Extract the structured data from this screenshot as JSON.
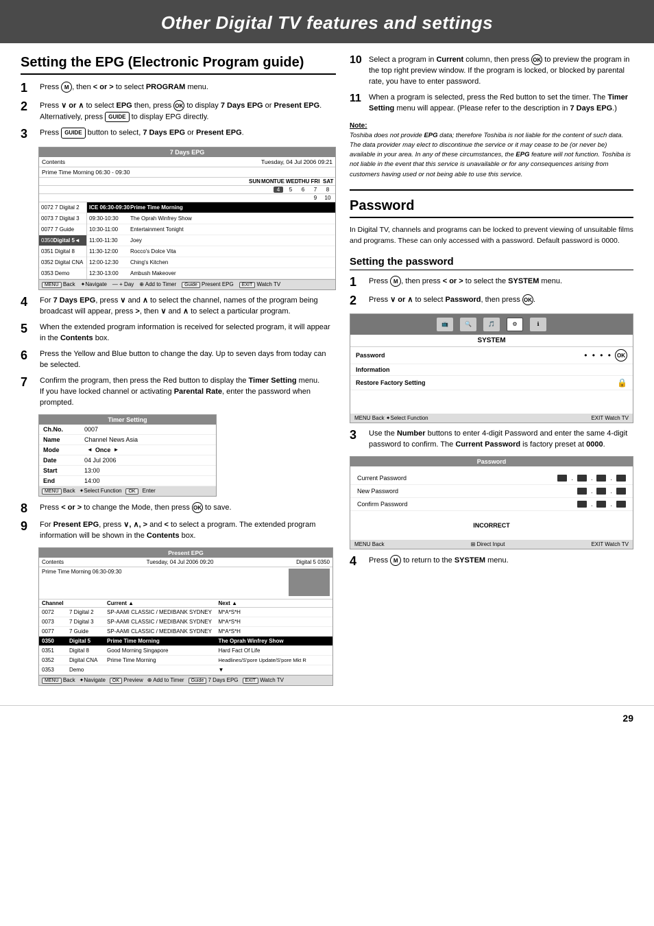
{
  "header": {
    "title": "Other Digital TV features and settings"
  },
  "left": {
    "section_title": "Setting the EPG (Electronic Program guide)",
    "steps": [
      {
        "num": "1",
        "text_parts": [
          "Press ",
          "MENU",
          ", then ",
          "< or >",
          " to select ",
          "PROGRAM",
          " menu."
        ]
      },
      {
        "num": "2",
        "text_parts": [
          "Press ",
          "∨ or ∧",
          " to select ",
          "EPG",
          " then, press ",
          "OK",
          " to display ",
          "7 Days EPG",
          " or ",
          "Present EPG",
          ". Alternatively, press ",
          "GUIDE",
          " to display EPG directly."
        ]
      },
      {
        "num": "3",
        "text_parts": [
          "Press ",
          "GUIDE",
          " button to select, ",
          "7 Days EPG",
          " or ",
          "Present EPG",
          "."
        ]
      }
    ],
    "epg_table": {
      "title": "7 Days EPG",
      "contents_label": "Contents",
      "date_label": "Tuesday, 04 Jul 2006 09:21",
      "program_label": "Prime Time Morning 06:30 - 09:30",
      "days": [
        "SUN",
        "MON",
        "TUE",
        "WED",
        "THU",
        "FRI",
        "SAT"
      ],
      "day_nums": [
        "4",
        "5",
        "6",
        "7",
        "8"
      ],
      "highlighted_day": "4",
      "extra_nums": [
        "9",
        "10"
      ],
      "channels": [
        {
          "num": "0072",
          "name": "7 Digital 2",
          "highlighted": false
        },
        {
          "num": "0073",
          "name": "7 Digital 3",
          "highlighted": false
        },
        {
          "num": "0077",
          "name": "7 Guide",
          "highlighted": false
        },
        {
          "num": "0350",
          "name": "Digital 5",
          "highlighted": true
        },
        {
          "num": "0351",
          "name": "Digital 8",
          "highlighted": false
        },
        {
          "num": "0352",
          "name": "Digital CNA",
          "highlighted": false
        },
        {
          "num": "0353",
          "name": "Demo",
          "highlighted": false
        }
      ],
      "programs": [
        {
          "time": "ICE 06:30-09:30",
          "name": "Prime Time Morning",
          "highlighted": true
        },
        {
          "time": "09:30-10:30",
          "name": "The Oprah Winfrey Show",
          "highlighted": false
        },
        {
          "time": "10:30-11:00",
          "name": "Entertainment Tonight",
          "highlighted": false
        },
        {
          "time": "11:00-11:30",
          "name": "Joey",
          "highlighted": false
        },
        {
          "time": "11:30-12:00",
          "name": "Rocco's Dolce Vita",
          "highlighted": false
        },
        {
          "time": "12:00-12:30",
          "name": "Ching's Kitchen",
          "highlighted": false
        },
        {
          "time": "12:30-13:00",
          "name": "Ambush Makeover",
          "highlighted": false
        }
      ],
      "footer_items": [
        "MENU Back",
        "✦Navigate",
        "— + Day",
        "⊕ Add to Timer",
        "Guide Present EPG",
        "EXIT Watch TV"
      ]
    },
    "steps4to7": [
      {
        "num": "4",
        "text": "For 7 Days EPG, press ∨ and ∧ to select the channel, names of the program being broadcast will appear, press >, then ∨ and ∧ to select a particular program."
      },
      {
        "num": "5",
        "text": "When the extended program information is received for selected program, it will appear in the Contents box."
      },
      {
        "num": "6",
        "text": "Press the Yellow and Blue button to change the day. Up to seven days from today can be selected."
      },
      {
        "num": "7",
        "text": "Confirm the program, then press the Red button to display the Timer Setting menu.\nIf you have locked channel or activating Parental Rate, enter the password when prompted."
      }
    ],
    "timer_table": {
      "title": "Timer Setting",
      "rows": [
        {
          "label": "Ch.No.",
          "value": "0007"
        },
        {
          "label": "Name",
          "value": "Channel News Asia"
        },
        {
          "label": "Mode",
          "arrow_left": "◄",
          "value": "Once",
          "arrow_right": "►",
          "bold": true
        },
        {
          "label": "Date",
          "value": "04 Jul 2006"
        },
        {
          "label": "Start",
          "value": "13:00"
        },
        {
          "label": "End",
          "value": "14:00"
        }
      ],
      "footer_items": [
        "MENU Back",
        "✦Select Function",
        "OK",
        "Enter"
      ]
    },
    "steps8to9": [
      {
        "num": "8",
        "text": "Press < or > to change the Mode, then press OK to save."
      },
      {
        "num": "9",
        "text": "For Present EPG, press ∨, ∧, > and < to select a program. The extended program information will be shown in the Contents box."
      }
    ],
    "pepg_table": {
      "title": "Present EPG",
      "contents_label": "Contents",
      "date_label": "Tuesday, 04 Jul 2006 09:20",
      "digital_label": "Digital 5 0350",
      "program_label": "Prime Time Morning 06:30-09:30",
      "col_headers": [
        "Channel",
        "Current ▲",
        "Next ▲"
      ],
      "channels": [
        {
          "num": "0072",
          "name": "7 Digital 2",
          "current": "SP-AAMI CLASSIC / MEDIBANK SYDNEY",
          "next": "M*A*S*H",
          "highlighted": false
        },
        {
          "num": "0073",
          "name": "7 Digital 3",
          "current": "SP-AAMI CLASSIC / MEDIBANK SYDNEY",
          "next": "M*A*S*H",
          "highlighted": false
        },
        {
          "num": "0077",
          "name": "7 Guide",
          "current": "SP-AAMI CLASSIC / MEDIBANK SYDNEY",
          "next": "M*A*S*H",
          "highlighted": false
        },
        {
          "num": "0350",
          "name": "Digital 5",
          "current": "Prime Time Morning",
          "next": "The Oprah Winfrey Show",
          "highlighted": true
        },
        {
          "num": "0351",
          "name": "Digital 8",
          "current": "Good Morning Singapore",
          "next": "Hard Fact Of Life",
          "highlighted": false
        },
        {
          "num": "0352",
          "name": "Digital CNA",
          "current": "Prime Time Morning",
          "next": "Headlines/S'pore Update/S'pore Mkt R",
          "highlighted": false
        },
        {
          "num": "0353",
          "name": "Demo",
          "current": "",
          "next": "",
          "highlighted": false
        }
      ],
      "footer_items": [
        "MENU Back",
        "✦Navigate",
        "OK Preview",
        "⊕ Add to Timer",
        "Guide 7 Days EPG",
        "EXIT Watch TV"
      ]
    }
  },
  "right": {
    "steps10to11": [
      {
        "num": "10",
        "text": "Select a program in Current column, then press OK to preview the program in the top right preview window. If the program is locked, or blocked by parental rate, you have to enter password."
      },
      {
        "num": "11",
        "text": "When a program is selected, press the Red button to set the timer. The Timer Setting menu will appear. (Please refer to the description in 7 Days EPG.)"
      }
    ],
    "note": {
      "label": "Note:",
      "text": "Toshiba does not provide EPG data; therefore Toshiba is not liable for the content of such data. The data provider may elect to discontinue the service or it may cease to be (or never be) available in your area. In any of these circumstances, the EPG feature will not function. Toshiba is not liable in the event that this service is unavailable or for any consequences arising from customers having used or not being able to use this service."
    },
    "password_section": {
      "title": "Password",
      "intro_text": "In Digital TV, channels and programs can be locked to prevent viewing of unsuitable films and programs. These can only accessed with a password. Default password is 0000.",
      "setting_title": "Setting the password",
      "steps": [
        {
          "num": "1",
          "text": "Press MENU, then press < or > to select the SYSTEM menu."
        },
        {
          "num": "2",
          "text": "Press ∨ or ∧ to select Password, then press OK."
        }
      ],
      "digital_settings": {
        "icons": [
          "📺",
          "🔍",
          "🎵",
          "📋",
          "🔧"
        ],
        "system_label": "SYSTEM",
        "rows": [
          {
            "label": "Password",
            "value": "• • • •",
            "show_ok": true,
            "show_lock": false
          },
          {
            "label": "Information",
            "value": "",
            "show_ok": false,
            "show_lock": false
          },
          {
            "label": "Restore Factory Setting",
            "value": "",
            "show_ok": false,
            "show_lock": true
          }
        ],
        "footer_left": "MENU Back ✦Select Function",
        "footer_right": "EXIT Watch TV"
      },
      "step3": {
        "num": "3",
        "text": "Use the Number buttons to enter 4-digit Password and enter the same 4-digit password to confirm. The Current Password is factory preset at 0000."
      },
      "password_panel": {
        "title": "Password",
        "rows": [
          {
            "label": "Current Password",
            "dots": 4
          },
          {
            "label": "New Password",
            "dots": 3
          },
          {
            "label": "Confirm Password",
            "dots": 3
          }
        ],
        "incorrect_label": "INCORRECT",
        "footer_left": "MENU Back",
        "footer_center": "⊞ Direct Input",
        "footer_right": "EXIT Watch TV"
      },
      "step4": {
        "num": "4",
        "text": "Press MENU to return to the SYSTEM menu."
      }
    }
  },
  "page_number": "29"
}
